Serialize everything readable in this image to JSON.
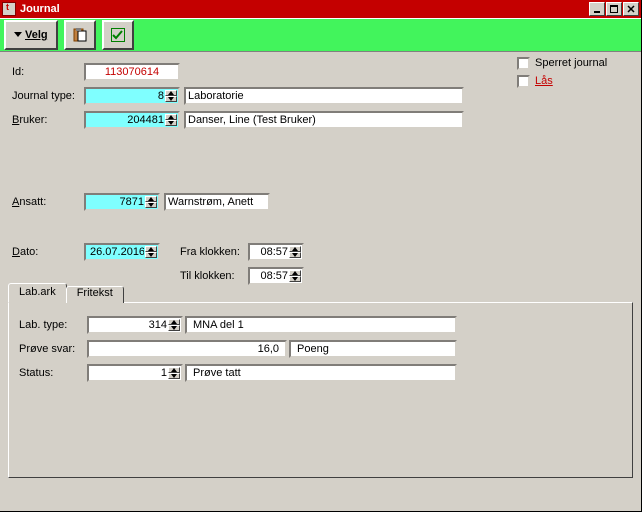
{
  "window": {
    "title": "Journal"
  },
  "toolbar": {
    "velg_label": "Velg"
  },
  "form": {
    "id_label": "Id:",
    "id_value": "113070614",
    "journal_type_label": "Journal type:",
    "journal_type_value": "8",
    "journal_type_text": "Laboratorie",
    "bruker_label": "Bruker:",
    "bruker_value": "204481",
    "bruker_text": "Danser, Line (Test Bruker)",
    "ansatt_label": "Ansatt:",
    "ansatt_value": "7871",
    "ansatt_text": "Warnstrøm, Anett",
    "dato_label": "Dato:",
    "dato_value": "26.07.2016",
    "fra_klokken_label": "Fra klokken:",
    "til_klokken_label": "Til klokken:",
    "fra_time": "08:57",
    "til_time": "08:57"
  },
  "right": {
    "sperret_label": "Sperret journal",
    "laas_label": "Lås"
  },
  "tabs": {
    "labark": "Lab.ark",
    "fritekst": "Fritekst",
    "lab_type_label": "Lab. type:",
    "lab_type_value": "314",
    "lab_type_text": "MNA del 1",
    "prove_svar_label": "Prøve svar:",
    "prove_svar_value": "16,0",
    "prove_svar_unit": "Poeng",
    "status_label": "Status:",
    "status_value": "1",
    "status_text": "Prøve tatt"
  }
}
